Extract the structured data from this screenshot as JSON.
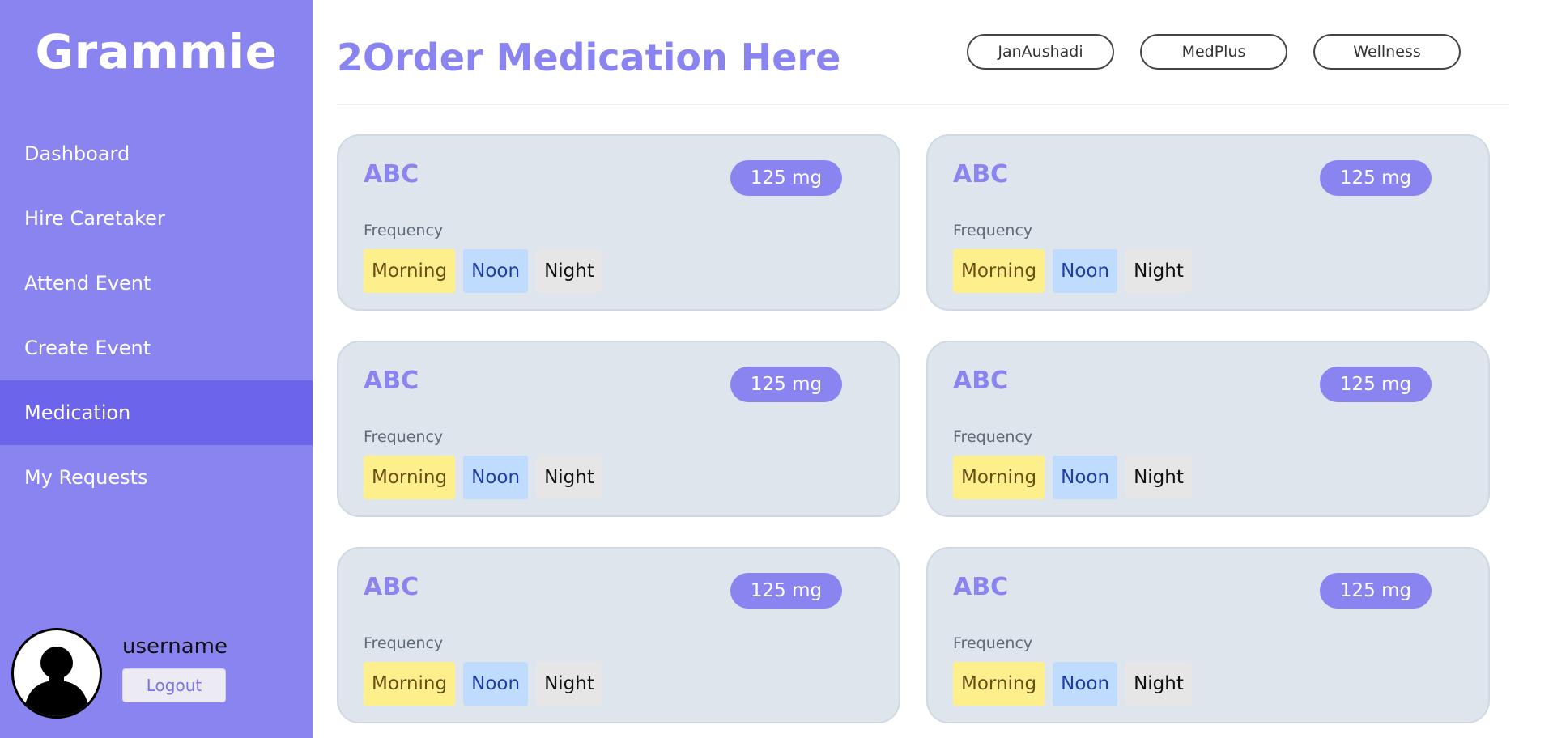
{
  "sidebar": {
    "brand": "Grammie",
    "items": [
      {
        "label": "Dashboard"
      },
      {
        "label": "Hire Caretaker"
      },
      {
        "label": "Attend Event"
      },
      {
        "label": "Create Event"
      },
      {
        "label": "Medication"
      },
      {
        "label": "My Requests"
      }
    ],
    "active_item": "Medication",
    "profile": {
      "username": "username",
      "logout_label": "Logout"
    }
  },
  "main": {
    "title": "2Order Medication Here",
    "stores": [
      "JanAushadi",
      "MedPlus",
      "Wellness"
    ],
    "medications": [
      {
        "name": "ABC",
        "dose": "125 mg",
        "frequency_label": "Frequency",
        "times": [
          "Morning",
          "Noon",
          "Night"
        ]
      },
      {
        "name": "ABC",
        "dose": "125 mg",
        "frequency_label": "Frequency",
        "times": [
          "Morning",
          "Noon",
          "Night"
        ]
      },
      {
        "name": "ABC",
        "dose": "125 mg",
        "frequency_label": "Frequency",
        "times": [
          "Morning",
          "Noon",
          "Night"
        ]
      },
      {
        "name": "ABC",
        "dose": "125 mg",
        "frequency_label": "Frequency",
        "times": [
          "Morning",
          "Noon",
          "Night"
        ]
      },
      {
        "name": "ABC",
        "dose": "125 mg",
        "frequency_label": "Frequency",
        "times": [
          "Morning",
          "Noon",
          "Night"
        ]
      },
      {
        "name": "ABC",
        "dose": "125 mg",
        "frequency_label": "Frequency",
        "times": [
          "Morning",
          "Noon",
          "Night"
        ]
      }
    ]
  },
  "colors": {
    "accent": "#8a84f1",
    "sidebar_active": "#6c64ea",
    "card_bg": "#dee5ed",
    "morning_chip": "#fdf08c",
    "noon_chip": "#bfdbfd",
    "night_chip": "#e6e6e6"
  },
  "icons": {
    "avatar": "user-silhouette-icon"
  }
}
